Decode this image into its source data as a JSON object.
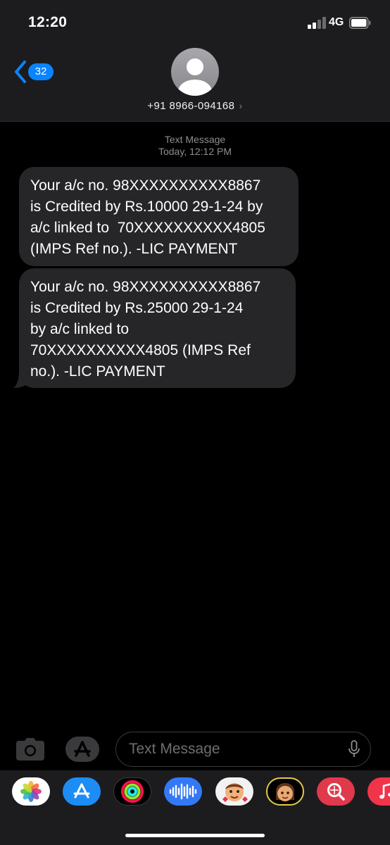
{
  "status_bar": {
    "time": "12:20",
    "network": "4G"
  },
  "header": {
    "back_badge": "32",
    "contact": "+91 8966-094168"
  },
  "thread": {
    "meta_type": "Text Message",
    "meta_time": "Today, 12:12 PM",
    "messages": [
      "Your a/c no. 98XXXXXXXXXX8867\nis Credited by Rs.10000 29-1-24 by\na/c linked to  70XXXXXXXXXX4805\n(IMPS Ref no.). -LIC PAYMENT",
      "Your a/c no. 98XXXXXXXXXX8867\nis Credited by Rs.25000 29-1-24\nby a/c linked to\n70XXXXXXXXXX4805 (IMPS Ref\nno.). -LIC PAYMENT"
    ]
  },
  "input_bar": {
    "placeholder": "Text Message"
  },
  "app_drawer": {
    "apps": [
      "photos-icon",
      "app-store-icon",
      "activity-icon",
      "audio-message-icon",
      "memoji-stickers-icon",
      "memoji-icon",
      "search-images-icon",
      "music-icon"
    ]
  },
  "colors": {
    "accent": "#0a84ff",
    "bubble": "#262628",
    "bar": "#1c1c1e"
  }
}
